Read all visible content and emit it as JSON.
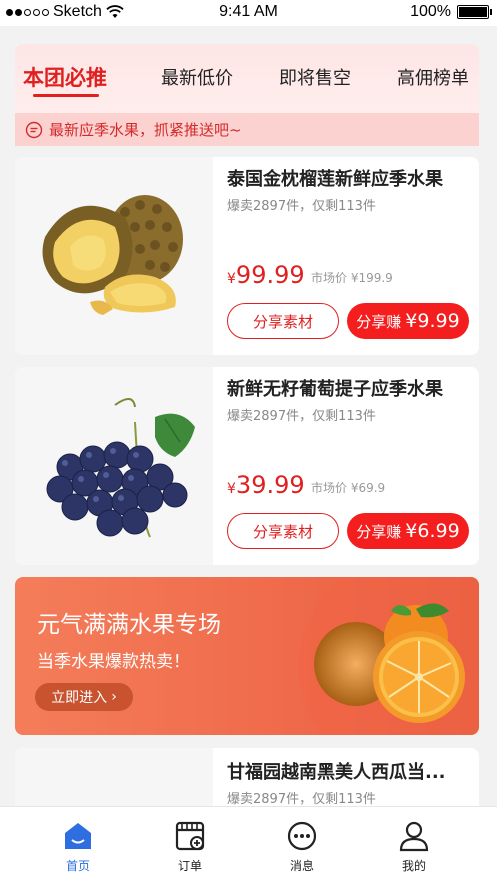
{
  "status_bar": {
    "carrier": "Sketch",
    "time": "9:41 AM",
    "battery": "100%",
    "battery_level": 1.0
  },
  "tabs": [
    {
      "label": "本团必推",
      "active": true
    },
    {
      "label": "最新低价",
      "active": false
    },
    {
      "label": "即将售空",
      "active": false
    },
    {
      "label": "高佣榜单",
      "active": false
    }
  ],
  "notice": {
    "text": "最新应季水果，抓紧推送吧~",
    "icon": "message-icon"
  },
  "products": [
    {
      "title": "泰国金枕榴莲新鲜应季水果",
      "sold_info": "爆卖2897件，仅剩113件",
      "currency": "¥",
      "price": "99.99",
      "market_price": "市场价 ¥199.9",
      "share_label": "分享素材",
      "earn_label": "分享赚",
      "earn_amount": "¥9.99",
      "image": "durian-image"
    },
    {
      "title": "新鲜无籽葡萄提子应季水果",
      "sold_info": "爆卖2897件，仅剩113件",
      "currency": "¥",
      "price": "39.99",
      "market_price": "市场价 ¥69.9",
      "share_label": "分享素材",
      "earn_label": "分享赚",
      "earn_amount": "¥6.99",
      "image": "grape-image"
    }
  ],
  "banner": {
    "title": "元气满满水果专场",
    "subtitle": "当季水果爆款热卖！",
    "button": "立即进入",
    "image": "orange-image"
  },
  "partial_product": {
    "title": "甘福园越南黑美人西瓜当...",
    "sold_info": "爆卖2897件，仅剩113件"
  },
  "tab_bar": [
    {
      "label": "首页",
      "icon": "home-icon",
      "active": true
    },
    {
      "label": "订单",
      "icon": "order-icon",
      "active": false
    },
    {
      "label": "消息",
      "icon": "message-icon",
      "active": false
    },
    {
      "label": "我的",
      "icon": "profile-icon",
      "active": false
    }
  ],
  "colors": {
    "accent": "#e02020",
    "tab_active": "#2e6ee0",
    "banner": "#ef6a4a"
  }
}
